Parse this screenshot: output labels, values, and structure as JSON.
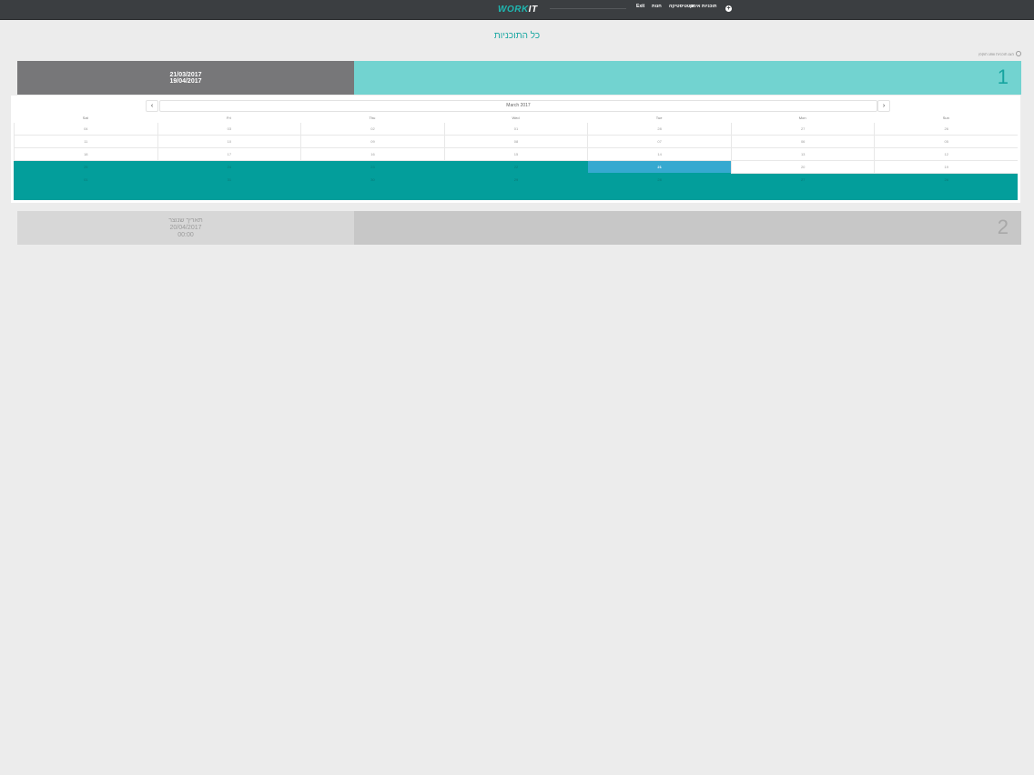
{
  "topbar": {
    "logo_work": "WORK",
    "logo_it": "IT",
    "nav_exit": "Exit",
    "nav_store": "חנות",
    "nav_stats": "סטטיסטיקה",
    "nav_training": "תוכניות אימון",
    "add_symbol": "+"
  },
  "page": {
    "title": "כל התוכניות",
    "show_expired": "הצג תוכניות שפג תוקפן"
  },
  "plans": [
    {
      "number": "1",
      "start": "21/03/2017",
      "end": "19/04/2017"
    },
    {
      "number": "2",
      "line1": "תאריך שנוצר",
      "date": "20/04/2017",
      "time": "00:00"
    }
  ],
  "calendar": {
    "month_label": "March 2017",
    "prev": "‹",
    "next": "›",
    "day_headers": [
      "Sat",
      "Fri",
      "Thu",
      "Wed",
      "Tue",
      "Mon",
      "Sun"
    ],
    "weeks": [
      [
        "04",
        "03",
        "02",
        "01",
        "28",
        "27",
        "26"
      ],
      [
        "11",
        "10",
        "09",
        "08",
        "07",
        "06",
        "05"
      ],
      [
        "18",
        "17",
        "16",
        "15",
        "14",
        "13",
        "12"
      ],
      [
        "25",
        "24",
        "23",
        "22",
        "21",
        "20",
        "19"
      ],
      [
        "01",
        "31",
        "30",
        "29",
        "28",
        "27",
        "26"
      ]
    ]
  }
}
